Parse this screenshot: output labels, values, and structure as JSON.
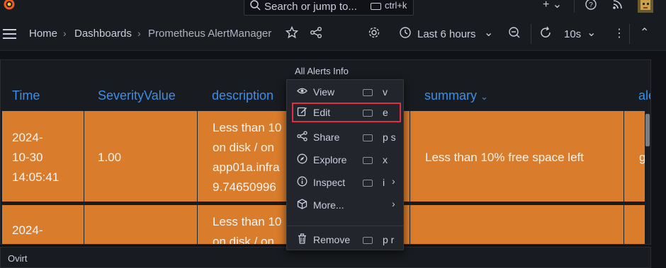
{
  "topbar": {
    "search_placeholder": "Search or jump to...",
    "search_shortcut": "ctrl+k"
  },
  "breadcrumb": {
    "home": "Home",
    "dashboards": "Dashboards",
    "current": "Prometheus AlertManager"
  },
  "toolbar": {
    "time_range": "Last 6 hours",
    "refresh_interval": "10s"
  },
  "panel": {
    "title": "All Alerts Info",
    "columns": [
      "Time",
      "SeverityValue",
      "description",
      "summary",
      "ale"
    ],
    "rows": [
      {
        "time": "2024-\n10-30\n14:05:41",
        "severity": "1.00",
        "description": "Less than 10\non disk / on\napp01a.infra\n9.74650996",
        "summary": "Less than 10% free space left",
        "alertname": "g"
      },
      {
        "time": "2024-",
        "severity": "",
        "description": "Less than 10\non disk / on",
        "summary": "",
        "alertname": ""
      }
    ]
  },
  "context_menu": {
    "items": [
      {
        "label": "View",
        "shortcut": "v",
        "icon": "eye-icon"
      },
      {
        "label": "Edit",
        "shortcut": "e",
        "icon": "edit-icon"
      },
      {
        "label": "Share",
        "shortcut": "p s",
        "icon": "share-icon"
      },
      {
        "label": "Explore",
        "shortcut": "x",
        "icon": "compass-icon"
      },
      {
        "label": "Inspect",
        "shortcut": "i",
        "icon": "info-icon"
      },
      {
        "label": "More...",
        "shortcut": "",
        "icon": "cube-icon"
      },
      {
        "label": "Remove",
        "shortcut": "p r",
        "icon": "trash-icon"
      }
    ]
  },
  "next_panel": {
    "title": "Ovirt"
  },
  "colors": {
    "row_bg": "#d97c2b",
    "header_text": "#3d8ee8",
    "highlight": "#e02f44"
  }
}
